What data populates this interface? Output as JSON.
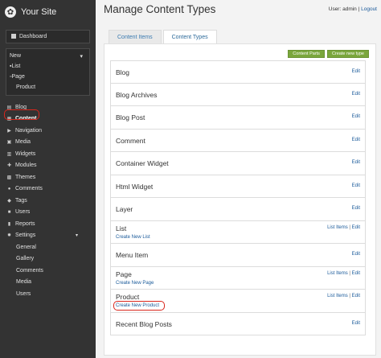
{
  "sidebar": {
    "site_name": "Your Site",
    "dashboard": "Dashboard",
    "new": {
      "label": "New",
      "items": [
        "List",
        "Page",
        "Product"
      ]
    },
    "nav": [
      {
        "label": "Blog",
        "icon": "blog-icon"
      },
      {
        "label": "Content",
        "icon": "content-icon"
      },
      {
        "label": "Navigation",
        "icon": "navigation-icon"
      },
      {
        "label": "Media",
        "icon": "media-icon"
      },
      {
        "label": "Widgets",
        "icon": "widgets-icon"
      },
      {
        "label": "Modules",
        "icon": "modules-icon"
      },
      {
        "label": "Themes",
        "icon": "themes-icon"
      },
      {
        "label": "Comments",
        "icon": "comments-icon"
      },
      {
        "label": "Tags",
        "icon": "tags-icon"
      },
      {
        "label": "Users",
        "icon": "users-icon"
      },
      {
        "label": "Reports",
        "icon": "reports-icon"
      },
      {
        "label": "Settings",
        "icon": "settings-icon"
      }
    ],
    "settings_sub": [
      "General",
      "Gallery",
      "Comments",
      "Media",
      "Users"
    ]
  },
  "header": {
    "title": "Manage Content Types",
    "user_prefix": "User: admin",
    "separator": " | ",
    "logout": "Logout"
  },
  "tabs": [
    {
      "label": "Content Items",
      "active": false
    },
    {
      "label": "Content Types",
      "active": true
    }
  ],
  "actions": {
    "content_parts": "Content Parts",
    "create_type": "Create new type"
  },
  "types": [
    {
      "name": "Blog",
      "edit": "Edit"
    },
    {
      "name": "Blog Archives",
      "edit": "Edit"
    },
    {
      "name": "Blog Post",
      "edit": "Edit"
    },
    {
      "name": "Comment",
      "edit": "Edit"
    },
    {
      "name": "Container Widget",
      "edit": "Edit"
    },
    {
      "name": "Html Widget",
      "edit": "Edit"
    },
    {
      "name": "Layer",
      "edit": "Edit"
    },
    {
      "name": "List",
      "list_items": "List Items",
      "edit": "Edit",
      "create": "Create New List"
    },
    {
      "name": "Menu Item",
      "edit": "Edit"
    },
    {
      "name": "Page",
      "list_items": "List Items",
      "edit": "Edit",
      "create": "Create New Page"
    },
    {
      "name": "Product",
      "list_items": "List Items",
      "edit": "Edit",
      "create": "Create New Product"
    },
    {
      "name": "Recent Blog Posts",
      "edit": "Edit"
    }
  ],
  "colors": {
    "sidebar_bg": "#333333",
    "accent_green": "#7aa63c",
    "link_blue": "#1a5a9a",
    "highlight_red": "#d9261c"
  }
}
